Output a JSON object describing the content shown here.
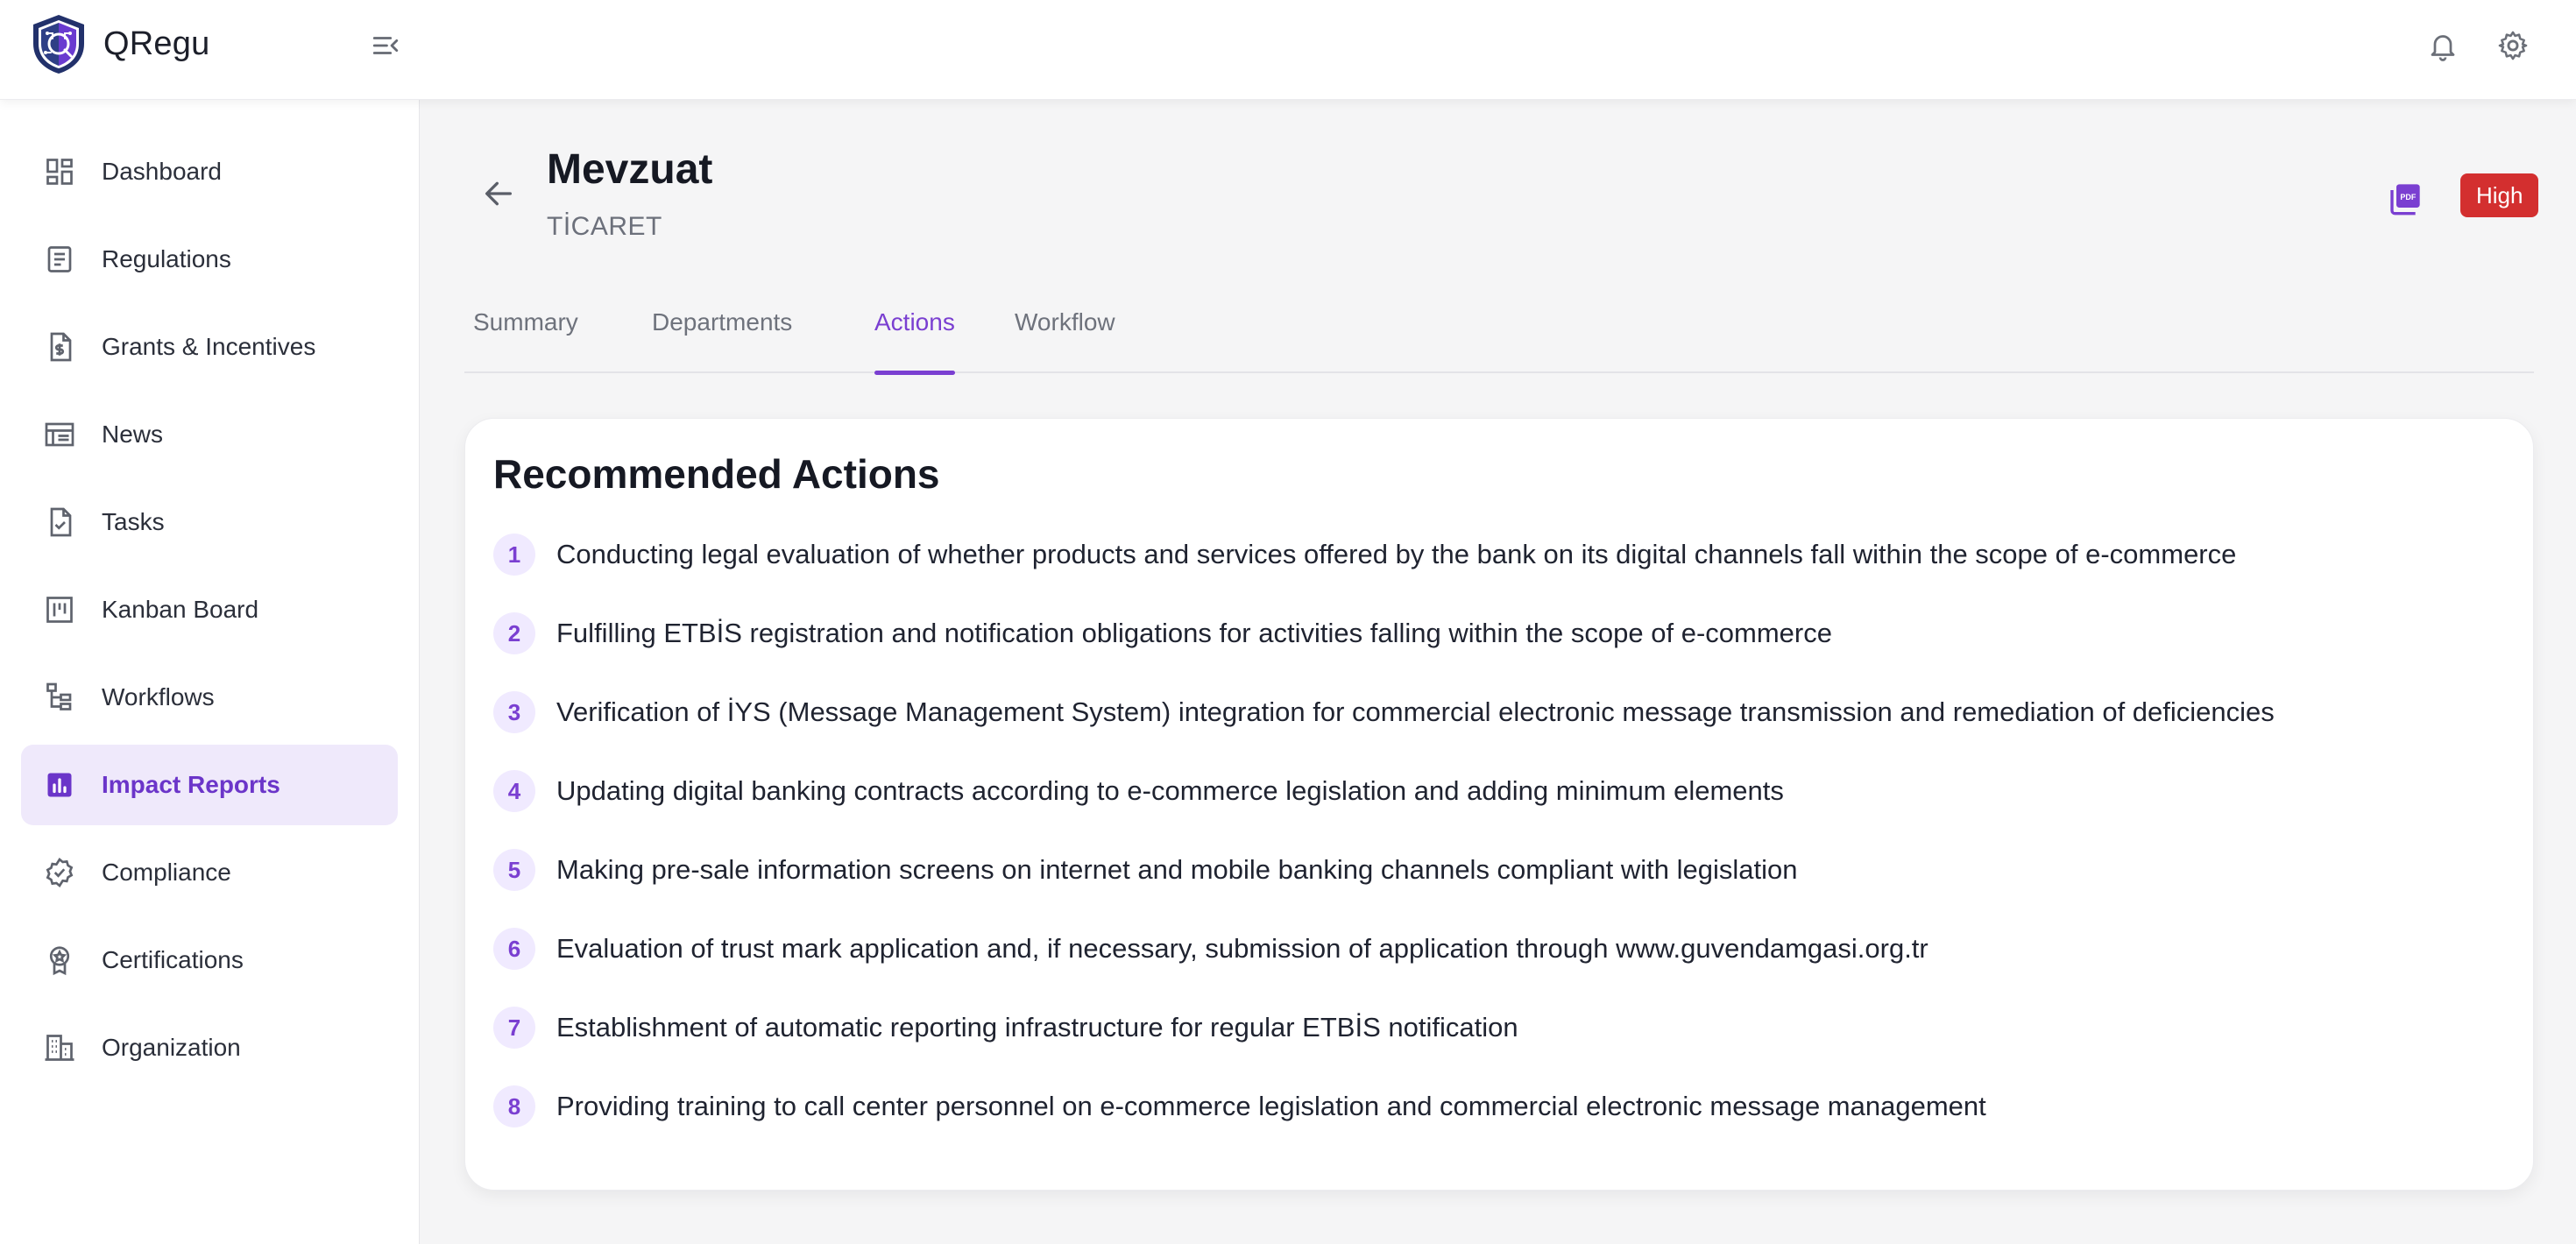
{
  "app": {
    "name": "QRegu"
  },
  "sidebar": {
    "items": [
      {
        "label": "Dashboard",
        "icon": "dashboard-icon"
      },
      {
        "label": "Regulations",
        "icon": "document-icon"
      },
      {
        "label": "Grants & Incentives",
        "icon": "dollar-file-icon"
      },
      {
        "label": "News",
        "icon": "news-icon"
      },
      {
        "label": "Tasks",
        "icon": "task-icon"
      },
      {
        "label": "Kanban Board",
        "icon": "kanban-icon"
      },
      {
        "label": "Workflows",
        "icon": "workflow-icon"
      },
      {
        "label": "Impact Reports",
        "icon": "chart-icon",
        "active": true
      },
      {
        "label": "Compliance",
        "icon": "verified-icon"
      },
      {
        "label": "Certifications",
        "icon": "badge-icon"
      },
      {
        "label": "Organization",
        "icon": "building-icon"
      }
    ]
  },
  "header": {
    "title": "Mevzuat",
    "subtitle": "TİCARET",
    "badge": "High"
  },
  "tabs": [
    {
      "label": "Summary"
    },
    {
      "label": "Departments"
    },
    {
      "label": "Actions",
      "active": true
    },
    {
      "label": "Workflow"
    }
  ],
  "card": {
    "title": "Recommended Actions",
    "actions": [
      {
        "num": "1",
        "text": "Conducting legal evaluation of whether products and services offered by the bank on its digital channels fall within the scope of e-commerce"
      },
      {
        "num": "2",
        "text": "Fulfilling ETBİS registration and notification obligations for activities falling within the scope of e-commerce"
      },
      {
        "num": "3",
        "text": "Verification of İYS (Message Management System) integration for commercial electronic message transmission and remediation of deficiencies"
      },
      {
        "num": "4",
        "text": "Updating digital banking contracts according to e-commerce legislation and adding minimum elements"
      },
      {
        "num": "5",
        "text": "Making pre-sale information screens on internet and mobile banking channels compliant with legislation"
      },
      {
        "num": "6",
        "text": "Evaluation of trust mark application and, if necessary, submission of application through www.guvendamgasi.org.tr"
      },
      {
        "num": "7",
        "text": "Establishment of automatic reporting infrastructure for regular ETBİS notification"
      },
      {
        "num": "8",
        "text": "Providing training to call center personnel on e-commerce legislation and commercial electronic message management"
      }
    ]
  },
  "colors": {
    "accent": "#7a3fd1",
    "badge": "#d32f2f",
    "active_bg": "#efe9fb"
  }
}
